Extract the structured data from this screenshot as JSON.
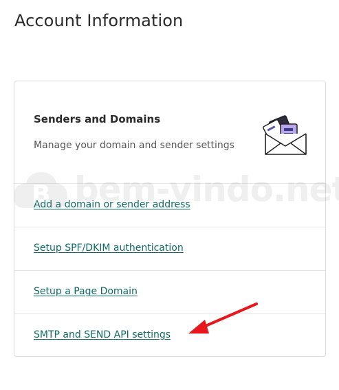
{
  "page": {
    "title": "Account Information"
  },
  "card": {
    "title": "Senders and Domains",
    "description": "Manage your domain and sender settings",
    "illustration_icon": "envelope-with-letters-icon",
    "links": [
      {
        "label": "Add a domain or sender address"
      },
      {
        "label": "Setup SPF/DKIM authentication"
      },
      {
        "label": "Setup a Page Domain"
      },
      {
        "label": "SMTP and SEND API settings"
      }
    ]
  },
  "watermark": {
    "text": "bem-vindo.net"
  },
  "annotation": {
    "icon": "red-arrow-icon",
    "color": "#e8171d"
  },
  "colors": {
    "link": "#0f6a66",
    "border": "#dcdcdc",
    "accent_purple": "#b8a6ea"
  }
}
